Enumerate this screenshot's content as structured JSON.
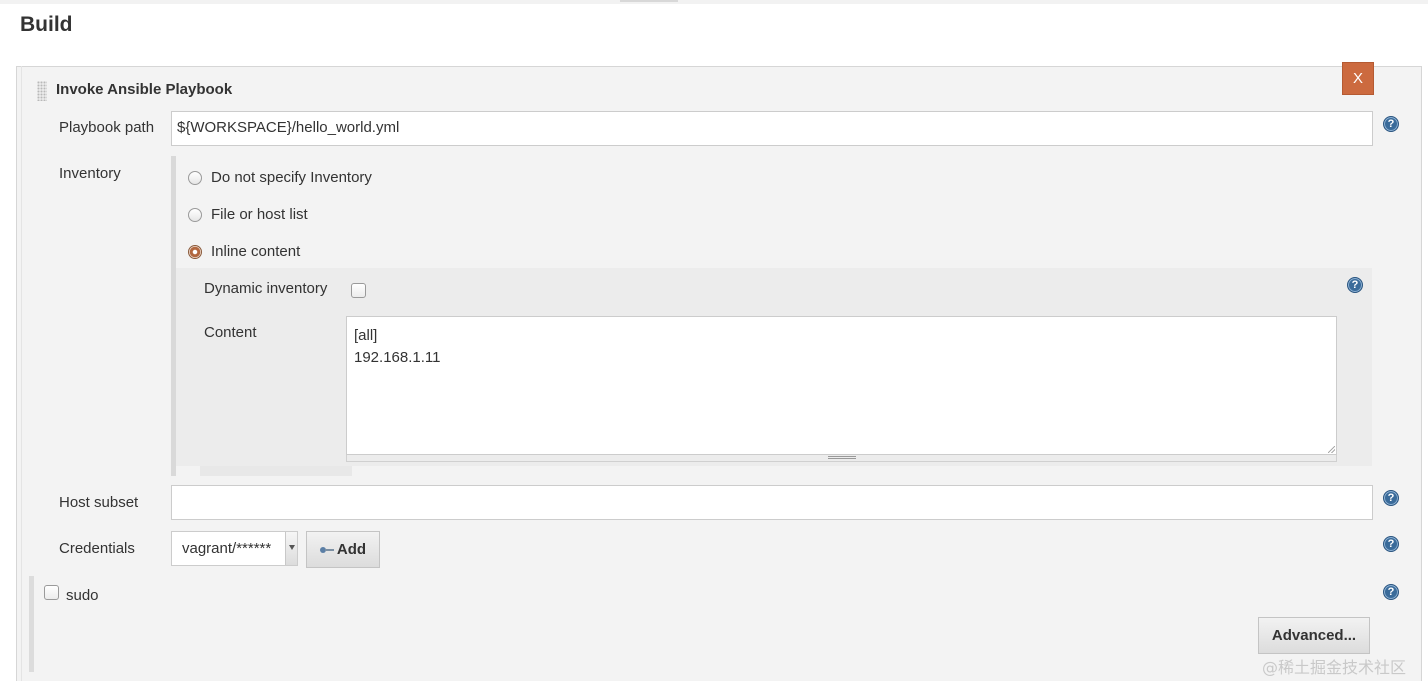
{
  "section": {
    "title": "Build"
  },
  "step": {
    "title": "Invoke Ansible Playbook",
    "delete_label": "X"
  },
  "playbook": {
    "label": "Playbook path",
    "value": "${WORKSPACE}/hello_world.yml"
  },
  "inventory": {
    "label": "Inventory",
    "options": [
      {
        "label": "Do not specify Inventory",
        "checked": false
      },
      {
        "label": "File or host list",
        "checked": false
      },
      {
        "label": "Inline content",
        "checked": true
      }
    ],
    "dynamic_label": "Dynamic inventory",
    "dynamic_checked": false,
    "content_label": "Content",
    "content_lines": [
      "[all]",
      "192.168.1.11"
    ]
  },
  "host_subset": {
    "label": "Host subset",
    "value": ""
  },
  "credentials": {
    "label": "Credentials",
    "selected": "vagrant/******",
    "add_label": "Add"
  },
  "sudo": {
    "label": "sudo",
    "checked": false
  },
  "advanced_label": "Advanced...",
  "help_glyph": "?",
  "watermark": "@稀土掘金技术社区"
}
